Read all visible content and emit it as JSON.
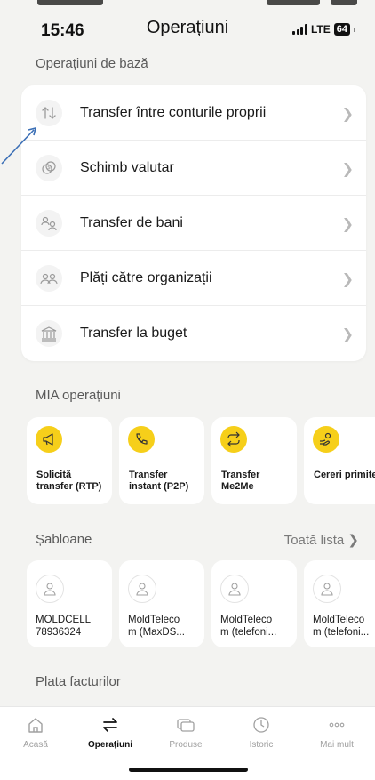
{
  "status_bar": {
    "time": "15:46",
    "title": "Operațiuni",
    "network": "LTE",
    "battery": "64"
  },
  "basic_ops": {
    "title": "Operațiuni de bază",
    "items": [
      {
        "label": "Transfer între conturile proprii",
        "icon": "swap-vertical-icon"
      },
      {
        "label": "Schimb valutar",
        "icon": "currency-exchange-icon"
      },
      {
        "label": "Transfer de bani",
        "icon": "person-transfer-icon"
      },
      {
        "label": "Plăți către organizații",
        "icon": "group-icon"
      },
      {
        "label": "Transfer la buget",
        "icon": "bank-building-icon"
      }
    ]
  },
  "mia": {
    "title": "MIA operațiuni",
    "items": [
      {
        "label": "Solicită transfer (RTP)",
        "icon": "megaphone-icon"
      },
      {
        "label": "Transfer instant (P2P)",
        "icon": "phone-icon"
      },
      {
        "label": "Transfer Me2Me",
        "icon": "repeat-icon"
      },
      {
        "label": "Cereri primite",
        "icon": "hand-coins-icon"
      }
    ]
  },
  "templates": {
    "title": "Șabloane",
    "see_all": "Toată lista",
    "items": [
      {
        "line1": "MOLDCELL",
        "line2": "78936324"
      },
      {
        "line1": "MoldTeleco",
        "line2": "m (MaxDS..."
      },
      {
        "line1": "MoldTeleco",
        "line2": "m (telefoni..."
      },
      {
        "line1": "MoldTeleco",
        "line2": "m (telefoni..."
      }
    ]
  },
  "bills": {
    "title": "Plata facturilor"
  },
  "tabbar": {
    "items": [
      {
        "label": "Acasă",
        "icon": "home-icon"
      },
      {
        "label": "Operațiuni",
        "icon": "transfer-arrows-icon"
      },
      {
        "label": "Produse",
        "icon": "cards-icon"
      },
      {
        "label": "Istoric",
        "icon": "clock-icon"
      },
      {
        "label": "Mai mult",
        "icon": "more-dots-icon"
      }
    ],
    "active": "Operațiuni"
  },
  "colors": {
    "accent": "#f6cf1a",
    "background": "#f3f3f1",
    "annotation_arrow": "#3b6fb6"
  }
}
